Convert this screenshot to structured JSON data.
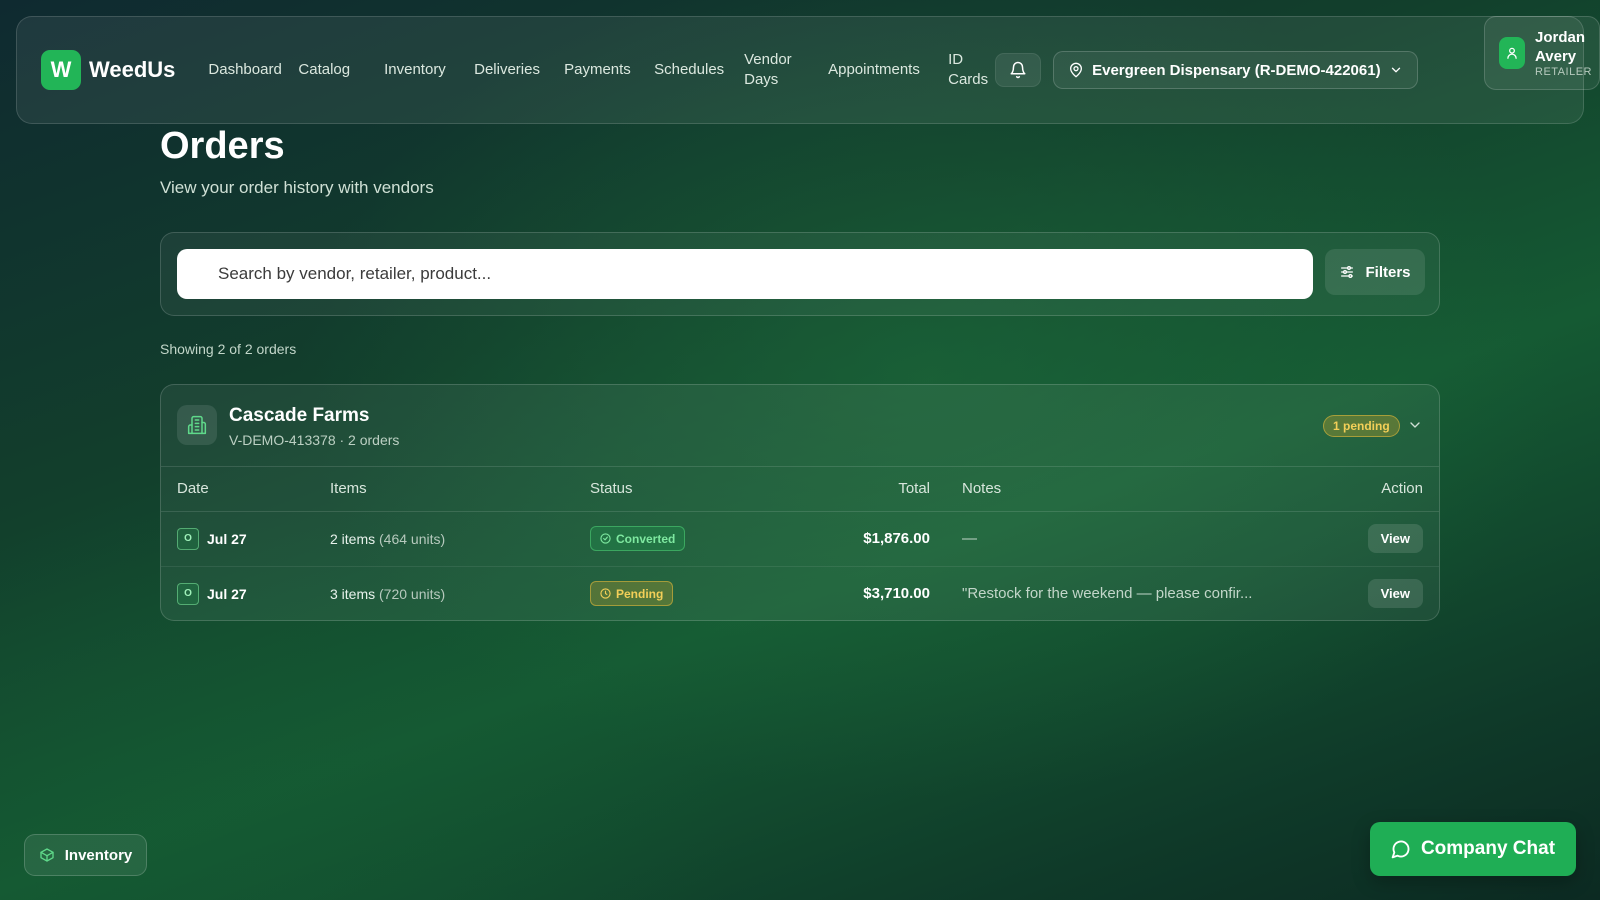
{
  "brand": {
    "logo_letter": "W",
    "name": "WeedUs"
  },
  "nav": {
    "items": [
      {
        "label": "Dashboard"
      },
      {
        "label": "Catalog"
      },
      {
        "label": "Inventory"
      },
      {
        "label": "Deliveries"
      },
      {
        "label": "Payments"
      },
      {
        "label": "Schedules"
      },
      {
        "label": "Vendor Days"
      },
      {
        "label": "Appointments"
      },
      {
        "label": "ID Cards"
      }
    ],
    "location": "Evergreen Dispensary (R-DEMO-422061)"
  },
  "user": {
    "name": "Jordan Avery",
    "role": "RETAILER"
  },
  "page": {
    "title": "Orders",
    "subtitle": "View your order history with vendors"
  },
  "search": {
    "placeholder": "Search by vendor, retailer, product...",
    "value": "",
    "filters_label": "Filters"
  },
  "results_summary": "Showing 2 of 2 orders",
  "vendor_group": {
    "name": "Cascade Farms",
    "meta": "V-DEMO-413378 · 2 orders",
    "pending_badge": "1 pending",
    "columns": [
      "Date",
      "Items",
      "Status",
      "Total",
      "Notes",
      "Action"
    ],
    "rows": [
      {
        "marker": "O",
        "date": "Jul 27",
        "items": "2 items",
        "units": "(464 units)",
        "status": "Converted",
        "total": "$1,876.00",
        "notes": "—",
        "action": "View"
      },
      {
        "marker": "O",
        "date": "Jul 27",
        "items": "3 items",
        "units": "(720 units)",
        "status": "Pending",
        "total": "$3,710.00",
        "notes": "\"Restock for the weekend — please confir...",
        "action": "View"
      }
    ]
  },
  "floating": {
    "inventory_label": "Inventory",
    "chat_label": "Company Chat"
  },
  "colors": {
    "accent": "#22b557",
    "converted": "#7ee8a0",
    "pending": "#f3cf58"
  }
}
